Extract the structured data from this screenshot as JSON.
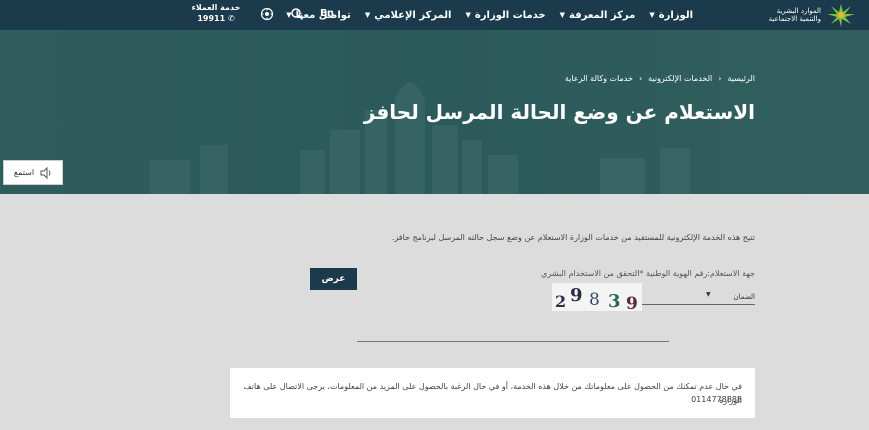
{
  "nav": {
    "logo_line1": "الموارد البشرية",
    "logo_line2": "والتنمية الاجتماعية",
    "menu": [
      {
        "label": "الوزارة"
      },
      {
        "label": "مركز المعرفة"
      },
      {
        "label": "خدمات الوزارة"
      },
      {
        "label": "المركز الإعلامي"
      },
      {
        "label": "تواصل معنا"
      }
    ],
    "lang": "En",
    "customer_service_label": "خدمة العملاء",
    "customer_service_phone": "19911"
  },
  "hero": {
    "breadcrumb": [
      "الرئيسية",
      "الخدمات الإلكترونية",
      "خدمات وكالة الرعاية"
    ],
    "title": "الاستعلام عن وضع الحالة المرسل لحافز"
  },
  "listen_label": "استمع",
  "form": {
    "intro": "تتيح هذه الخدمة الإلكترونية للمستفيد من خدمات الوزارة الاستعلام عن وضع سجل حالته المرسل لبرنامج حافز.",
    "field_label": "جهة الاستعلام:رقم الهوية الوطنية *التحقق من الاستخدام البشري",
    "select_value": "الضمان",
    "captcha_digits": [
      "2",
      "9",
      "8",
      "3",
      "9"
    ],
    "submit_label": "عرض"
  },
  "notice": {
    "text": "في حال عدم تمكنك من الحصول على معلوماتك من خلال هذه الخدمة، أو في حال الرغبة بالحصول على المزيد من المعلومات، يرجى الاتصال على هاتف الوزارة",
    "phone": "0114778888"
  },
  "colors": {
    "navy": "#1b3a4b",
    "hero_teal": "#2f5d5d",
    "page_bg": "#dcdcdc"
  }
}
